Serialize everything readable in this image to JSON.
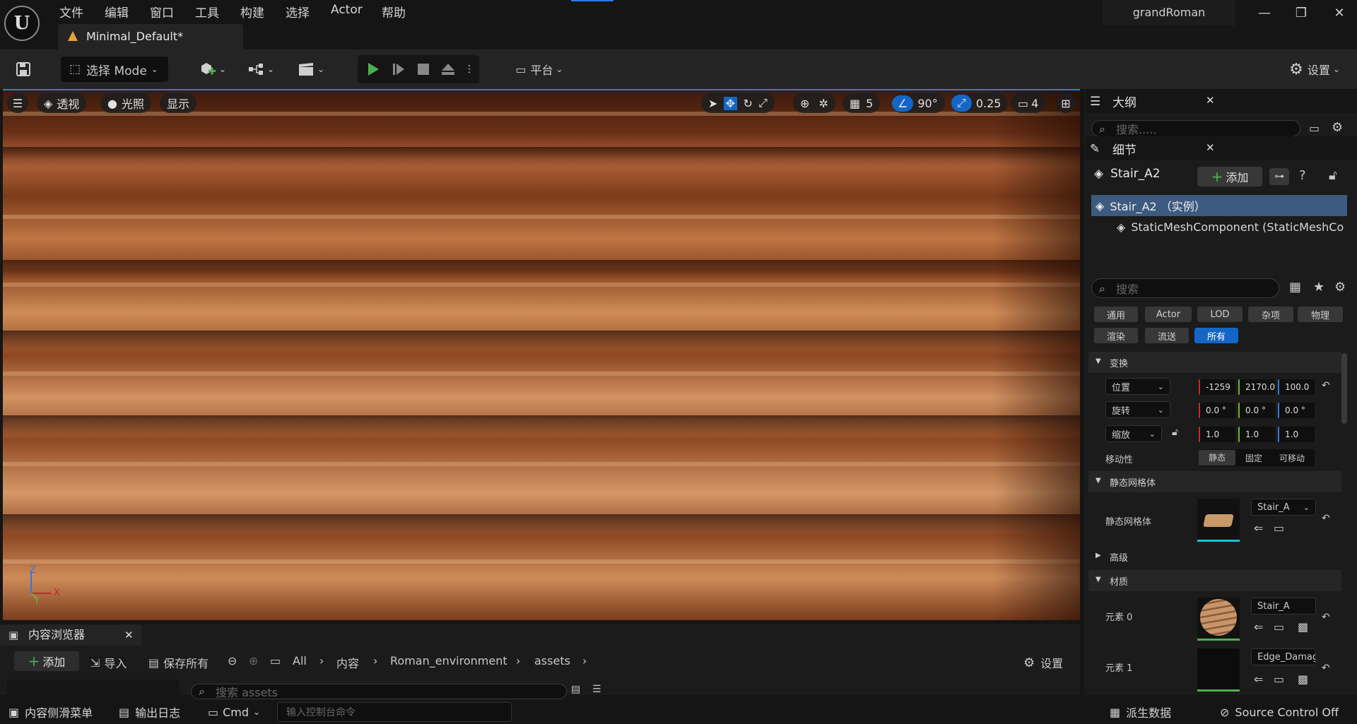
{
  "app": {
    "logo_letter": "U",
    "menu": [
      "文件",
      "编辑",
      "窗口",
      "工具",
      "构建",
      "选择",
      "Actor",
      "帮助"
    ],
    "project_name": "grandRoman",
    "tab_title": "Minimal_Default*"
  },
  "toolbar": {
    "mode_label": "选择 Mode",
    "platform_label": "平台",
    "settings_label": "设置"
  },
  "viewport": {
    "perspective_label": "透视",
    "lighting_label": "光照",
    "show_label": "显示",
    "grid_size": "5",
    "rotation_snap": "90°",
    "scale_snap": "0.25",
    "camera_speed": "4",
    "axis_z": "Z",
    "axis_x": "X",
    "axis_y": "Y"
  },
  "outliner": {
    "title": "大纲",
    "search_placeholder": "搜索....."
  },
  "details": {
    "title": "细节",
    "actor_name": "Stair_A2",
    "add_label": "添加",
    "tree_root": "Stair_A2 （实例）",
    "tree_child": "StaticMeshComponent (StaticMeshCo",
    "search_placeholder": "搜索",
    "filters_row1": [
      "通用",
      "Actor",
      "LOD",
      "杂项",
      "物理"
    ],
    "filters_row2": [
      "渲染",
      "流送",
      "所有"
    ],
    "transform_section": "变换",
    "location_label": "位置",
    "rotation_label": "旋转",
    "scale_label": "缩放",
    "location": [
      "-1259",
      "2170.0",
      "100.0"
    ],
    "rotation": [
      "0.0 °",
      "0.0 °",
      "0.0 °"
    ],
    "scale": [
      "1.0",
      "1.0",
      "1.0"
    ],
    "mobility_label": "移动性",
    "mobility_options": [
      "静态",
      "固定",
      "可移动"
    ],
    "static_mesh_section": "静态网格体",
    "static_mesh_label": "静态网格体",
    "static_mesh_value": "Stair_A",
    "advanced_label": "高级",
    "materials_section": "材质",
    "element0_label": "元素 0",
    "element0_value": "Stair_A",
    "element1_label": "元素 1",
    "element1_value": "Edge_Damaged"
  },
  "content_browser": {
    "title": "内容浏览器",
    "add_label": "添加",
    "import_label": "导入",
    "save_all_label": "保存所有",
    "breadcrumbs": [
      "All",
      "内容",
      "Roman_environment",
      "assets"
    ],
    "settings_label": "设置",
    "search_placeholder": "搜索 assets"
  },
  "statusbar": {
    "drawer_label": "内容侧滑菜单",
    "output_log_label": "输出日志",
    "cmd_label": "Cmd",
    "console_placeholder": "输入控制台命令",
    "derived_data_label": "派生数据",
    "source_control_label": "Source Control Off"
  },
  "colors": {
    "accent_blue": "#1466c6",
    "play_green": "#4caf50",
    "background": "#151515",
    "panel": "#1b1b1b"
  }
}
